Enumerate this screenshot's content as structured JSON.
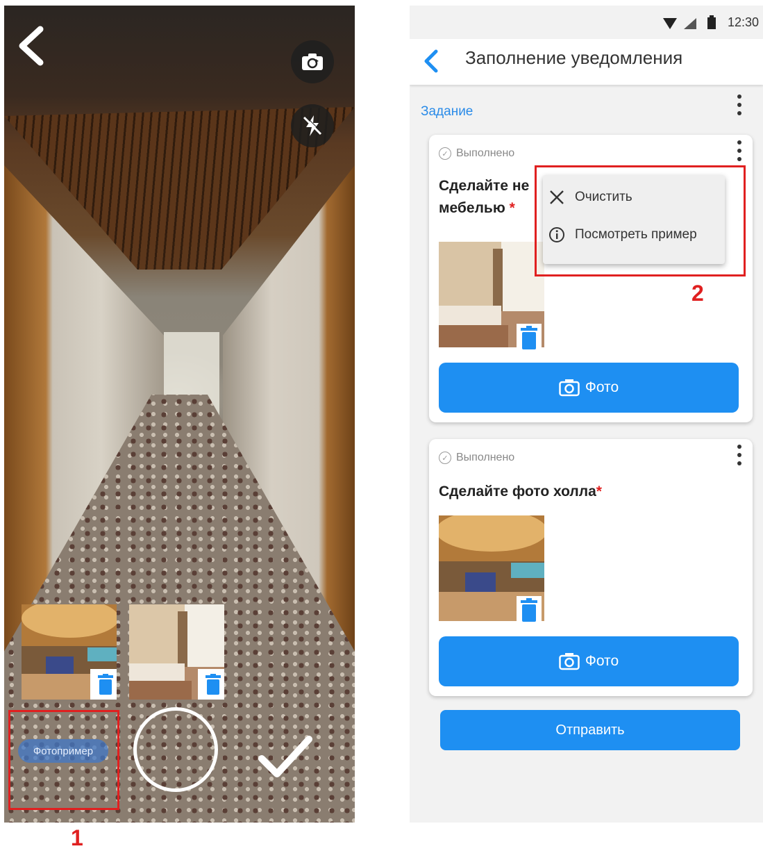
{
  "camera_screen": {
    "example_chip_label": "Фотопример",
    "annotation_number": "1"
  },
  "form_screen": {
    "status_time": "12:30",
    "title": "Заполнение уведомления",
    "section_label": "Задание",
    "cards": [
      {
        "status": "Выполнено",
        "title_line1": "Сделайте не",
        "title_line2": "мебелью",
        "required_mark": "*",
        "photo_button_label": "Фото"
      },
      {
        "status": "Выполнено",
        "title": "Сделайте фото холла",
        "required_mark": "*",
        "photo_button_label": "Фото"
      }
    ],
    "context_menu": {
      "items": [
        {
          "label": "Очистить",
          "icon": "close-icon"
        },
        {
          "label": "Посмотреть пример",
          "icon": "info-icon"
        }
      ]
    },
    "submit_label": "Отправить",
    "annotation_number": "2"
  },
  "colors": {
    "accent": "#1e8ff2",
    "annotation_red": "#e02020"
  }
}
